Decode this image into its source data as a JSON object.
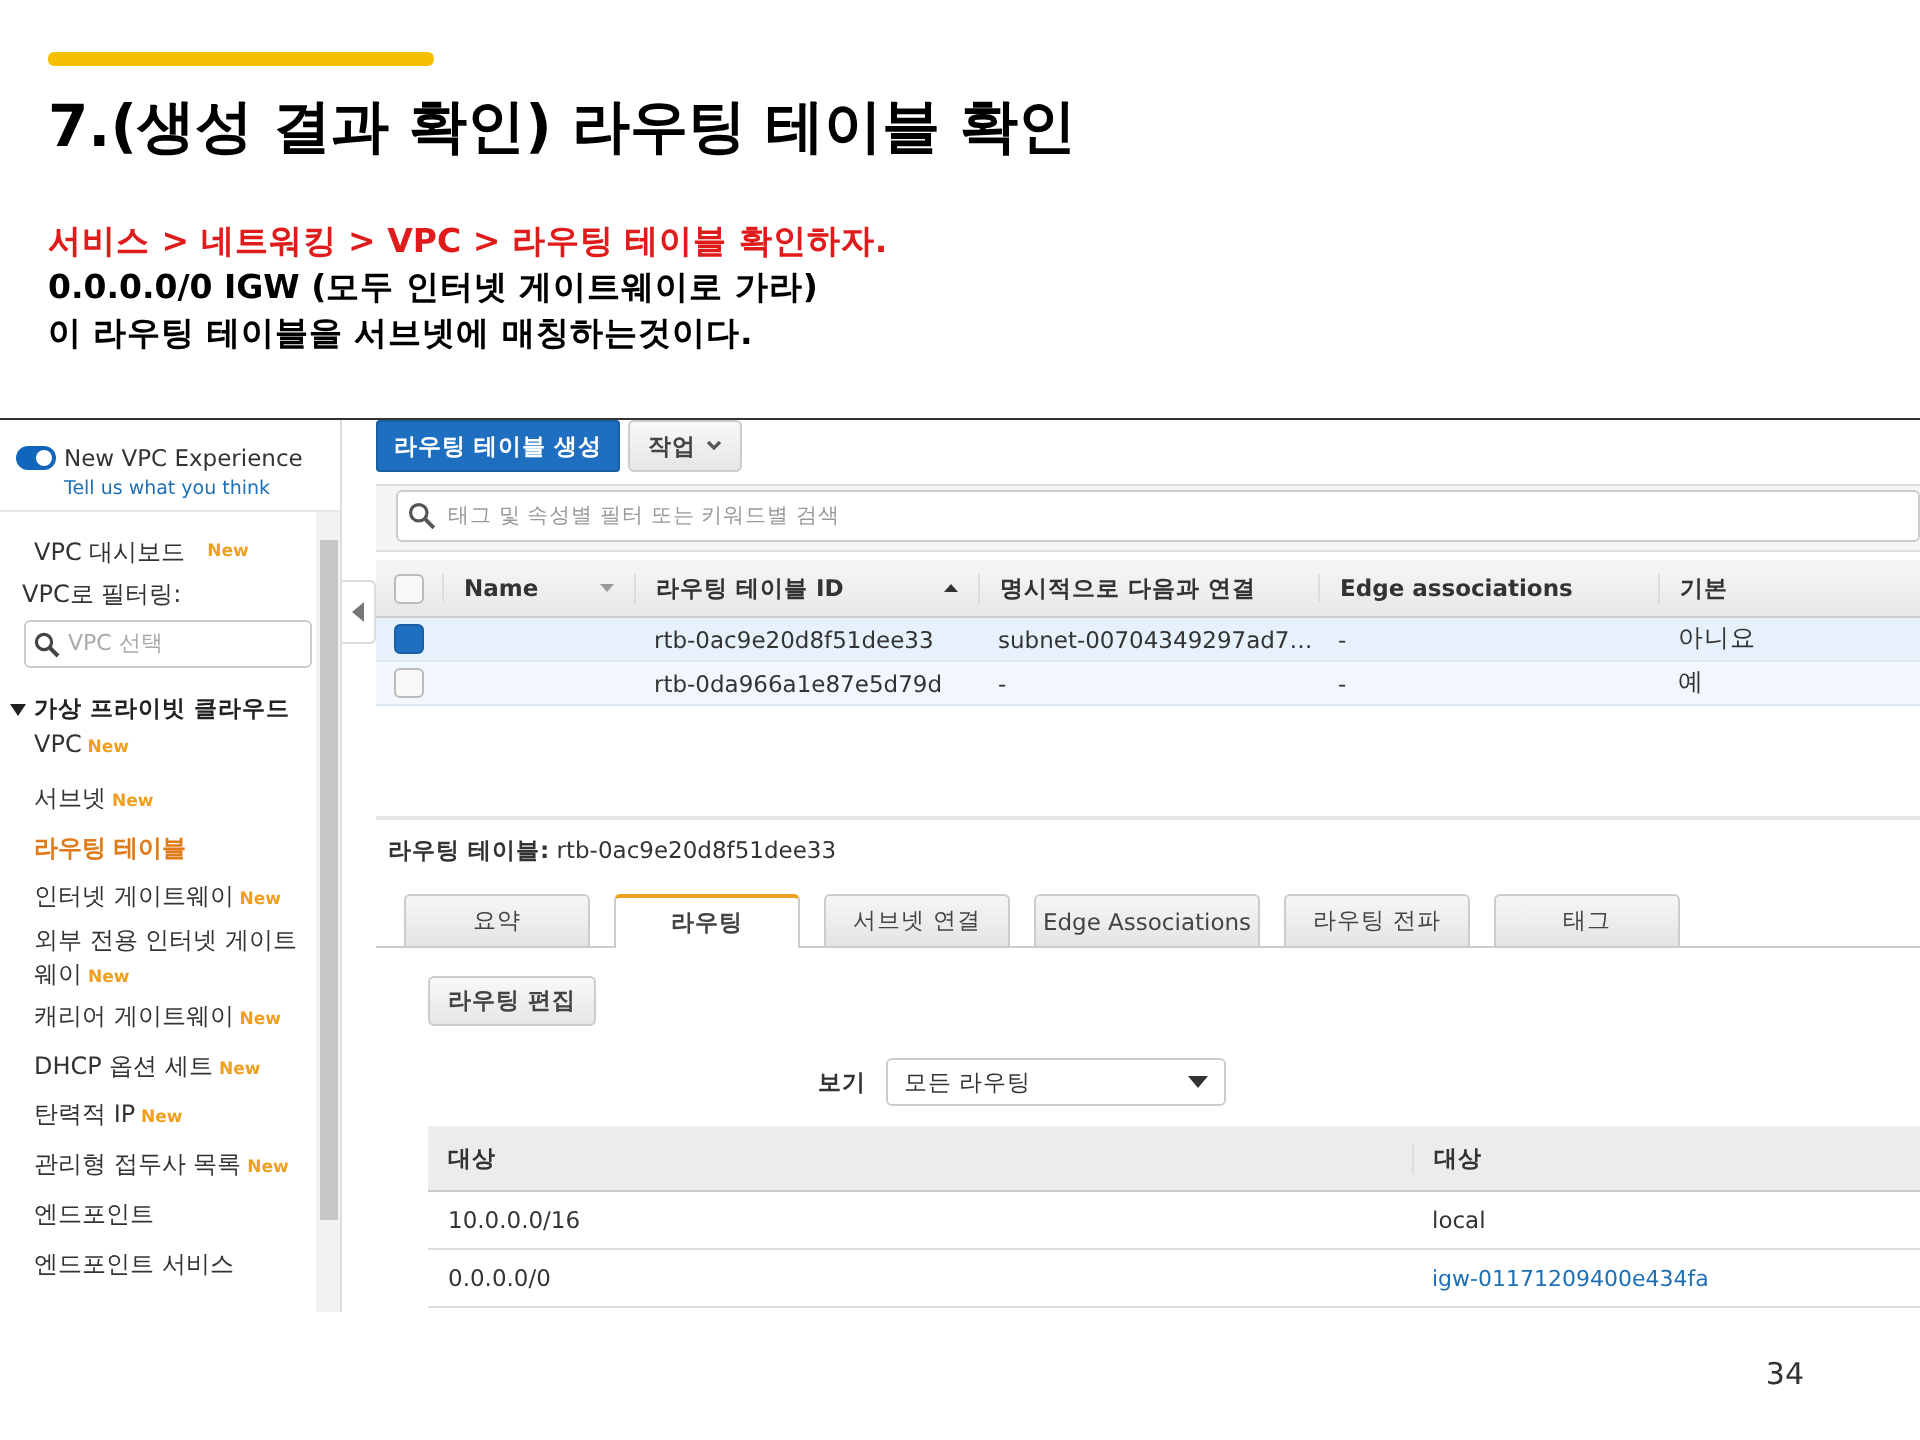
{
  "slide": {
    "title": "7.(생성 결과 확인) 라우팅 테이블 확인",
    "lines": [
      {
        "kind": "highlight",
        "text": "서비스 > 네트워킹 > VPC > 라우팅 테이블 확인하자."
      },
      {
        "kind": "normal",
        "text": "0.0.0.0/0 IGW (모두 인터넷 게이트웨이로 가라)"
      },
      {
        "kind": "normal",
        "text": "이 라우팅 테이블을 서브넷에 매칭하는것이다."
      }
    ],
    "page_number": "34"
  },
  "console": {
    "sidebar": {
      "toggle": {
        "label": "New VPC Experience",
        "on": true
      },
      "feedback_link": "Tell us what you think",
      "dashboard": {
        "label": "VPC 대시보드",
        "badge": "New"
      },
      "filter_label": "VPC로 필터링:",
      "filter": {
        "placeholder": "VPC 선택"
      },
      "group": {
        "label": "가상 프라이빗 클라우드",
        "expanded": true,
        "children": [
          {
            "label": "VPC",
            "badge": "New",
            "selected": false
          },
          {
            "label": "서브넷",
            "badge": "New",
            "selected": false
          },
          {
            "label": "라우팅 테이블",
            "selected": true
          },
          {
            "label": "인터넷 게이트웨이",
            "badge": "New",
            "selected": false
          },
          {
            "label": "외부 전용 인터넷 게이트웨이",
            "badge": "New",
            "selected": false
          },
          {
            "label": "캐리어 게이트웨이",
            "badge": "New",
            "selected": false
          },
          {
            "label": "DHCP 옵션 세트",
            "badge": "New",
            "selected": false
          },
          {
            "label": "탄력적 IP",
            "badge": "New",
            "selected": false
          },
          {
            "label": "관리형 접두사 목록",
            "badge": "New",
            "selected": false
          },
          {
            "label": "엔드포인트",
            "selected": false
          },
          {
            "label": "엔드포인트 서비스",
            "selected": false
          }
        ]
      }
    },
    "toolbar": {
      "create_button": "라우팅 테이블 생성",
      "actions_button": "작업"
    },
    "search": {
      "placeholder": "태그 및 속성별 필터 또는 키워드별 검색"
    },
    "table": {
      "all_selected": false,
      "columns": [
        "Name",
        "라우팅 테이블 ID",
        "명시적으로 다음과 연결",
        "Edge associations",
        "기본"
      ],
      "rows": [
        {
          "selected": true,
          "id": "rtb-0ac9e20d8f51dee33",
          "explicit": "subnet-00704349297ad7…",
          "edge": "-",
          "main": "아니요"
        },
        {
          "selected": false,
          "id": "rtb-0da966a1e87e5d79d",
          "explicit": "-",
          "edge": "-",
          "main": "예"
        }
      ]
    },
    "detail": {
      "label": "라우팅 테이블:",
      "value": "rtb-0ac9e20d8f51dee33",
      "tabs": [
        {
          "label": "요약",
          "selected": false
        },
        {
          "label": "라우팅",
          "selected": true
        },
        {
          "label": "서브넷 연결",
          "selected": false
        },
        {
          "label": "Edge Associations",
          "selected": false
        },
        {
          "label": "라우팅 전파",
          "selected": false
        },
        {
          "label": "태그",
          "selected": false
        }
      ],
      "edit_button": "라우팅 편집",
      "view_label": "보기",
      "view_select": "모든 라우팅",
      "routes": {
        "columns": [
          "대상",
          "대상"
        ],
        "rows": [
          {
            "destination": "10.0.0.0/16",
            "target": "local",
            "kind": "text"
          },
          {
            "destination": "0.0.0.0/0",
            "target": "igw-01171209400e434fa",
            "kind": "link"
          }
        ]
      }
    }
  }
}
